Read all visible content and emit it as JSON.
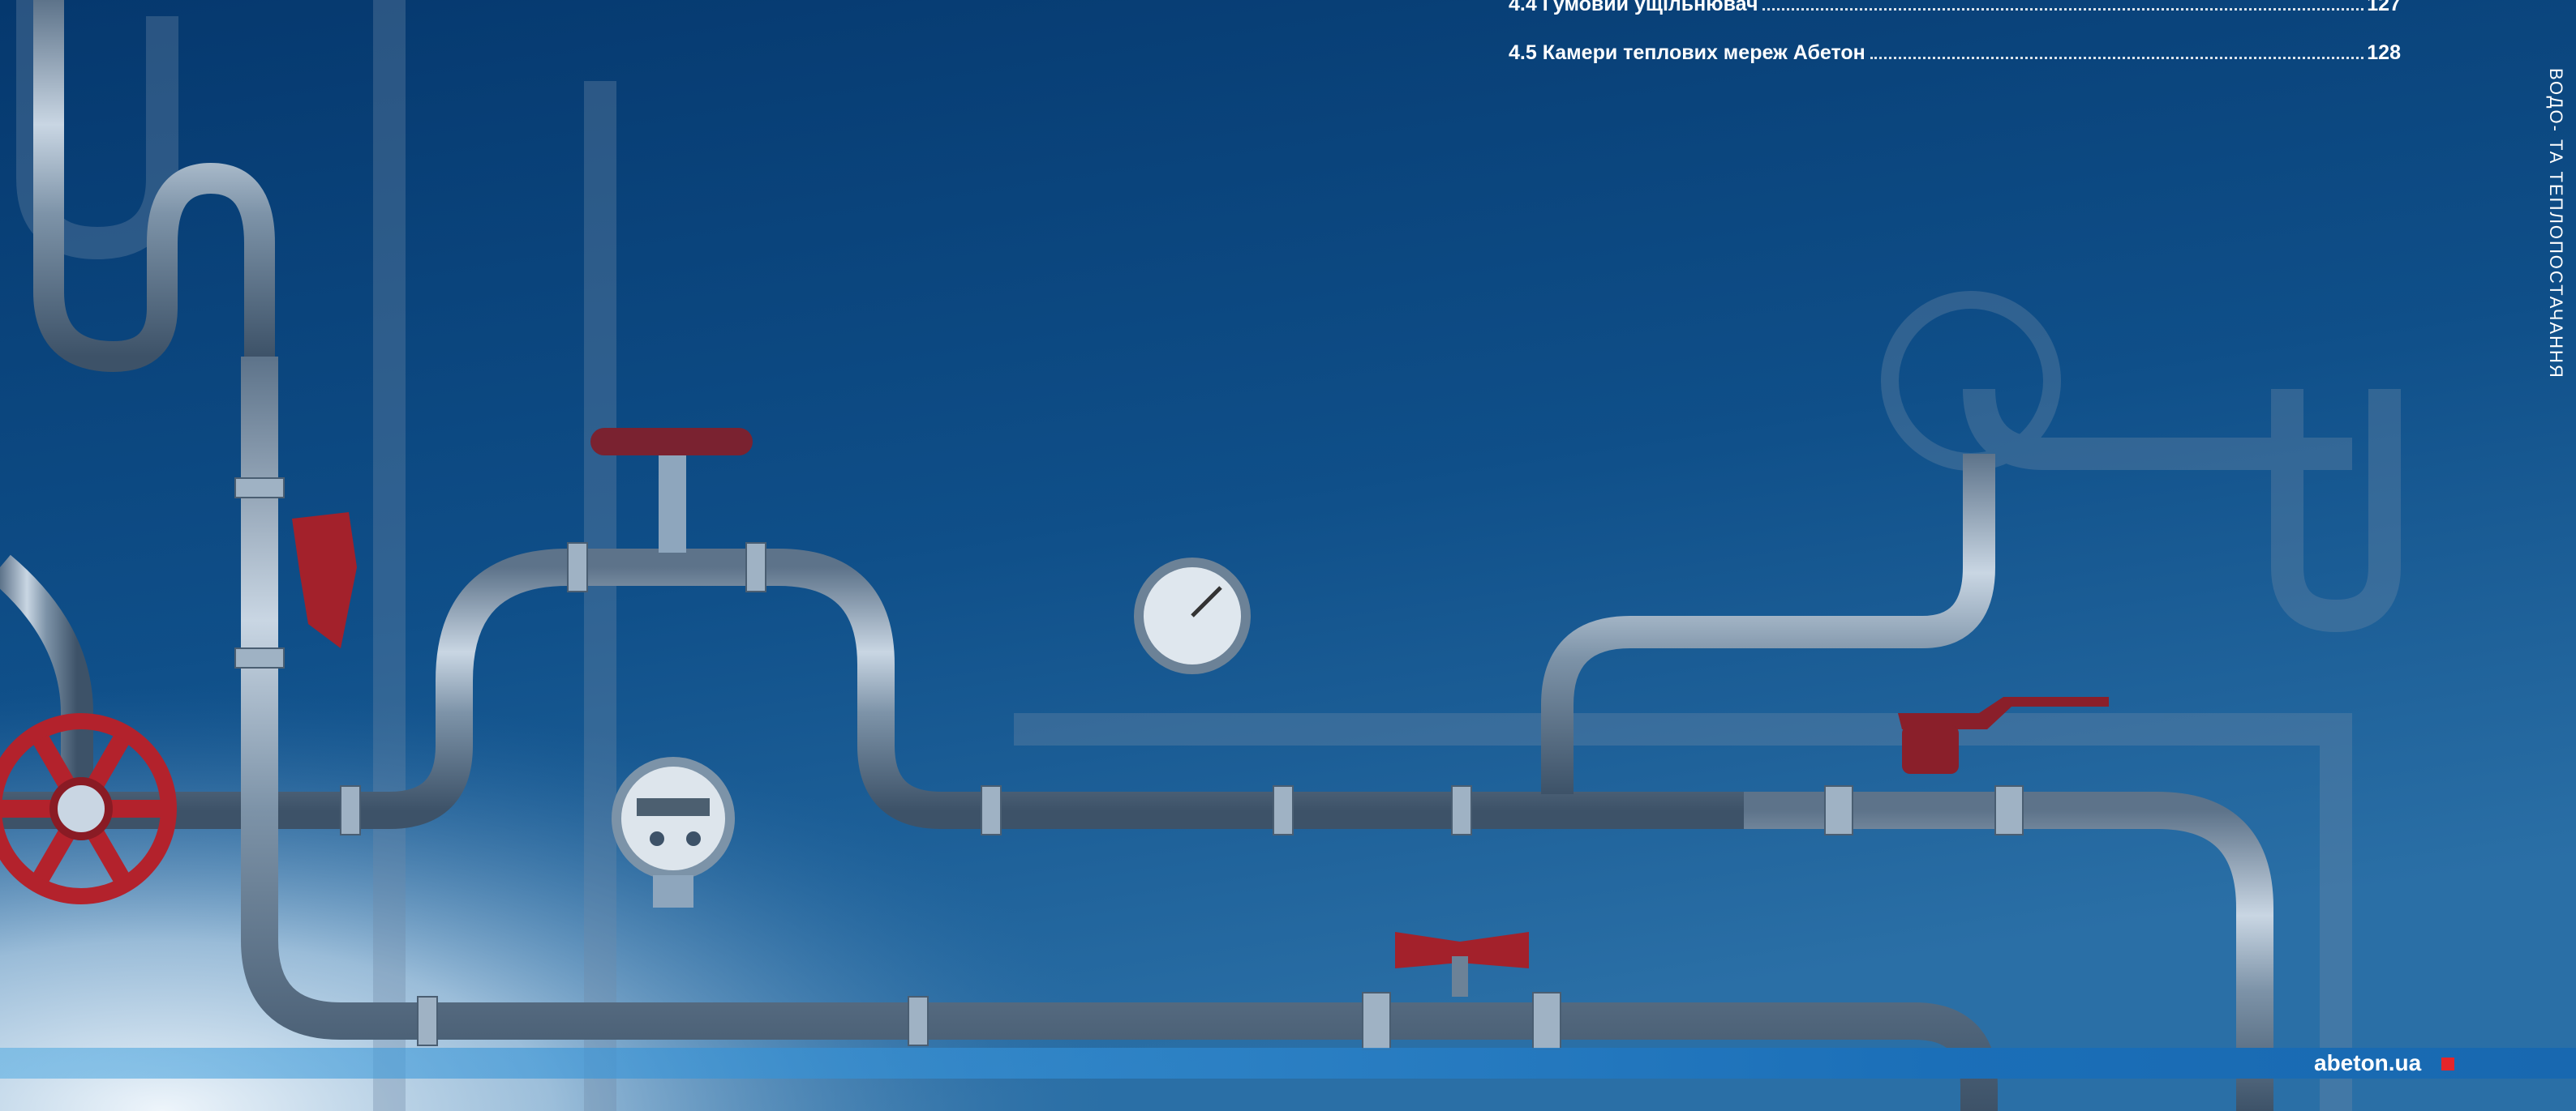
{
  "toc": {
    "items": [
      {
        "label": "4.4 Гумовий ущільнювач",
        "page": "127"
      },
      {
        "label": "4.5 Камери теплових мереж Абетон",
        "page": "128"
      }
    ]
  },
  "side_title": "ВОДО- ТА ТЕПЛОПОСТАЧАННЯ",
  "footer": {
    "site": "abeton.ua"
  },
  "colors": {
    "background_top": "#053a72",
    "pipe_steel": "#8ea6bd",
    "valve_red": "#b3222c",
    "footer_bar": "#1b6fb8",
    "brand_red": "#e5252a"
  },
  "icons": [
    "pipe-network-illustration",
    "red-wheel-valve-icon",
    "pressure-gauge-icon",
    "water-meter-icon",
    "butterfly-valve-icon",
    "ball-valve-icon"
  ]
}
